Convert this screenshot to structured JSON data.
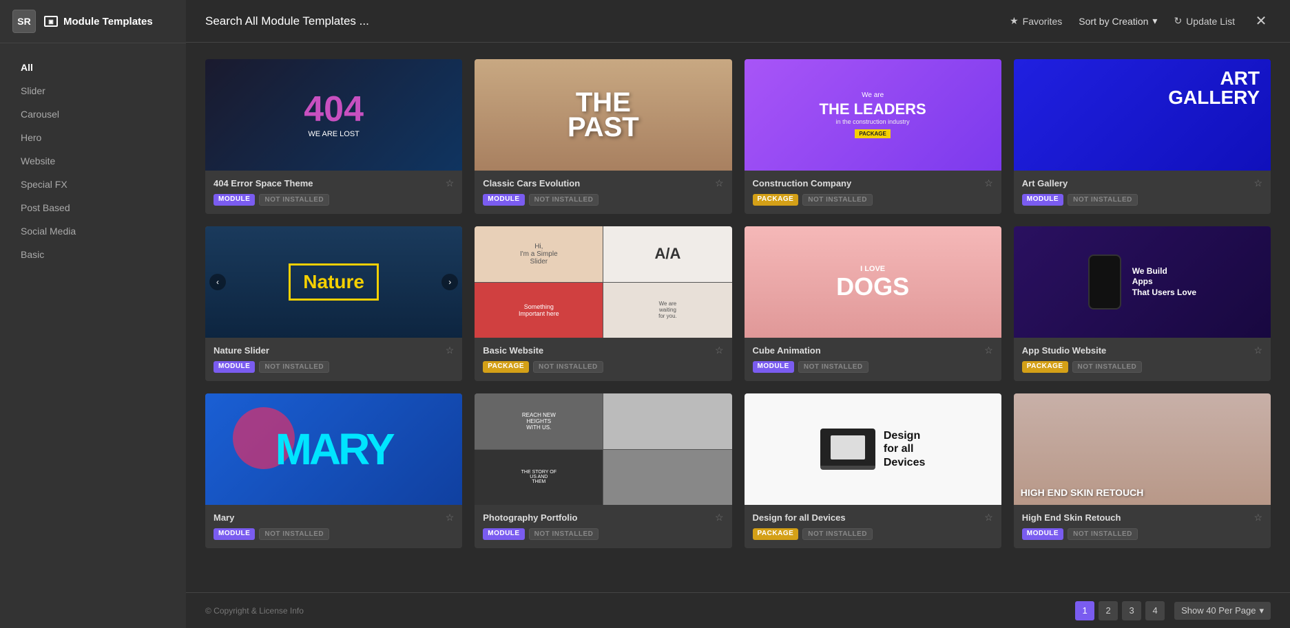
{
  "app": {
    "logo_text": "SR",
    "title": "Module Templates"
  },
  "sidebar": {
    "nav_items": [
      {
        "id": "all",
        "label": "All",
        "active": true
      },
      {
        "id": "slider",
        "label": "Slider",
        "active": false
      },
      {
        "id": "carousel",
        "label": "Carousel",
        "active": false
      },
      {
        "id": "hero",
        "label": "Hero",
        "active": false
      },
      {
        "id": "website",
        "label": "Website",
        "active": false
      },
      {
        "id": "special-fx",
        "label": "Special FX",
        "active": false
      },
      {
        "id": "post-based",
        "label": "Post Based",
        "active": false
      },
      {
        "id": "social-media",
        "label": "Social Media",
        "active": false
      },
      {
        "id": "basic",
        "label": "Basic",
        "active": false
      }
    ]
  },
  "topbar": {
    "search_placeholder": "Search All Module Templates ...",
    "favorites_label": "Favorites",
    "sort_label": "Sort by Creation",
    "update_label": "Update List"
  },
  "templates": [
    {
      "name": "404 Error Space Theme",
      "type": "MODULE",
      "status": "NOT INSTALLED",
      "starred": false,
      "thumb_class": "thumb-404"
    },
    {
      "name": "Classic Cars Evolution",
      "type": "MODULE",
      "status": "NOT INSTALLED",
      "starred": false,
      "thumb_class": "thumb-cars"
    },
    {
      "name": "Construction Company",
      "type": "PACKAGE",
      "status": "NOT INSTALLED",
      "starred": false,
      "thumb_class": "thumb-construction"
    },
    {
      "name": "Art Gallery",
      "type": "MODULE",
      "status": "NOT INSTALLED",
      "starred": false,
      "thumb_class": "thumb-artgallery"
    },
    {
      "name": "Nature Slider",
      "type": "MODULE",
      "status": "NOT INSTALLED",
      "starred": false,
      "thumb_class": "thumb-nature",
      "has_arrows": true
    },
    {
      "name": "Basic Website",
      "type": "PACKAGE",
      "status": "NOT INSTALLED",
      "starred": false,
      "thumb_class": "thumb-website"
    },
    {
      "name": "Cube Animation",
      "type": "MODULE",
      "status": "NOT INSTALLED",
      "starred": false,
      "thumb_class": "thumb-dogs"
    },
    {
      "name": "App Studio Website",
      "type": "PACKAGE",
      "status": "NOT INSTALLED",
      "starred": false,
      "thumb_class": "thumb-appstudio"
    },
    {
      "name": "Mary",
      "type": "MODULE",
      "status": "NOT INSTALLED",
      "starred": false,
      "thumb_class": "thumb-mary"
    },
    {
      "name": "Photography Portfolio",
      "type": "MODULE",
      "status": "NOT INSTALLED",
      "starred": false,
      "thumb_class": "thumb-photog"
    },
    {
      "name": "Design for all Devices",
      "type": "PACKAGE",
      "status": "NOT INSTALLED",
      "starred": false,
      "thumb_class": "thumb-design"
    },
    {
      "name": "High End Skin Retouch",
      "type": "MODULE",
      "status": "NOT INSTALLED",
      "starred": false,
      "thumb_class": "thumb-skin"
    }
  ],
  "footer": {
    "copyright": "© Copyright & License Info",
    "pages": [
      "1",
      "2",
      "3",
      "4"
    ],
    "active_page": "1",
    "per_page": "Show 40 Per Page"
  }
}
